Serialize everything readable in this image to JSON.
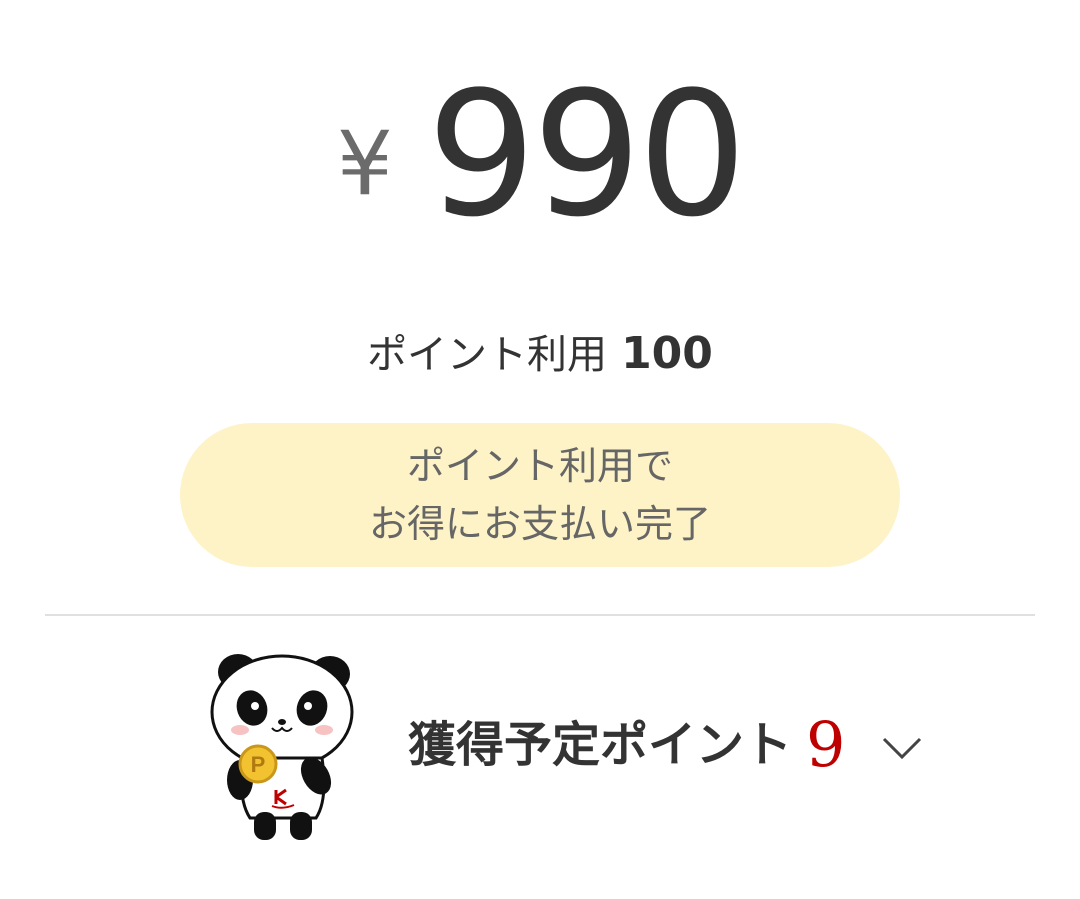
{
  "payment": {
    "currency_symbol": "¥",
    "amount": "990"
  },
  "points_used": {
    "label": "ポイント利用",
    "value": "100"
  },
  "status": {
    "line1": "ポイント利用で",
    "line2": "お得にお支払い完了"
  },
  "earned_points": {
    "label": "獲得予定ポイント",
    "value": "9",
    "value_color": "#bf0000",
    "toggle_icon": "chevron-down-icon"
  },
  "mascot": {
    "icon": "panda-mascot-icon"
  },
  "colors": {
    "status_background": "#fdf3c7",
    "accent_red": "#bf0000",
    "divider": "#e0e0e0"
  }
}
